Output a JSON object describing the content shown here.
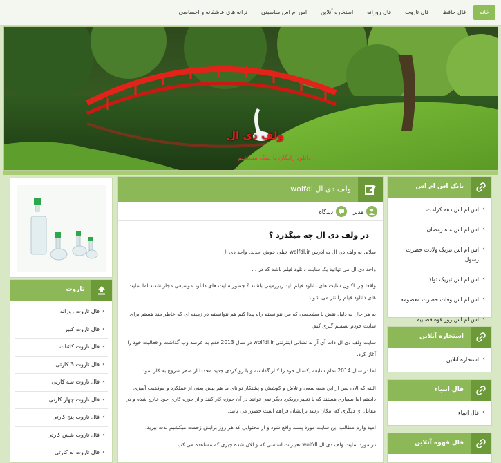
{
  "nav": {
    "items": [
      {
        "label": "خانه",
        "active": true
      },
      {
        "label": "فال حافظ"
      },
      {
        "label": "فال تاروت"
      },
      {
        "label": "فال روزانه"
      },
      {
        "label": "استخاره آنلاین"
      },
      {
        "label": "اس ام اس مناسبتی"
      },
      {
        "label": "ترانه های عاشقانه و احساسی"
      }
    ]
  },
  "banner": {
    "site_title": "ولف دی ال",
    "tagline": "دانلود رایگان با لینک مستقیم"
  },
  "article": {
    "title": "ولف دی ال wolfdl",
    "meta_author": "مدیر",
    "meta_comments": "دیدگاه",
    "heading": "در ولف دی ال چه میگذرد ؟",
    "paragraphs": [
      "سلام. به ولف دی ال به آدرس wolfdl.ir خیلی خوش آمدید. واحد دی ال",
      "واحد دی ال می توانید یک سایت دانلود فیلم باشد که در ...",
      "واقعا چرا اکنون سایت های دانلود فیلم باید زیرزمینی باشند ؟ چطور سایت های دانلود موسیقی مجاز شدند اما سایت های دانلود فیلم را نتر می شوند.",
      "به هر حال به دلیل نقض نا مشخصی که من نتوانستم راه پیدا کنم هم نتوانستم در زمینه ای که خاطر مند هستم برای سایت خودم تصمیم گیری کنم.",
      "سایت ولف دی ال دات آی آر به نشانی اینترنتی wolfdl.ir در سال 2013 قدم به عرصه وب گذاشت و فعالیت خود را آغاز کرد.",
      "اما در سال 2014 تمام سابقه یکسال خود را کنار گذاشته و با رویکردی جدید مجددا از صفر شروع به کار نمود.",
      "البته که الان پس از این همه سعی و تلاش و کوشش و پشتکار توانای ما هم پیش یعنی از عملکرد و موفقیت آمیزی داشتم اما بسیاری هستند که با تغییر رویکرد دیگر نمی توانند در آن حوزه کار کنند و از حوزه کاری خود خارج شده و در مقابل ای دیگری که امکان رشد برایشان فراهم است حضور می یابند.",
      "امید وارم مطالب این سایت مورد پسند واقع شود و از محتوایی که هر روز برایش زحمت میکشیم لذت ببرید.",
      "در مورد سایت ولف دی ال wolfdl تغییرات اساسی که و الان شده چیزی که مشاهده می کنید."
    ]
  },
  "right_widgets": [
    {
      "title": "بانک اس ام اس",
      "items": [
        "اس ام اس دهه کرامت",
        "اس ام اس ماه رمضان",
        "اس ام اس تبریک ولادت حضرت رسول",
        "اس ام اس تبریک تولد",
        "اس ام اس وفات حضرت معصومه",
        "اس ام اس روز قوه قضاییه"
      ]
    },
    {
      "title": "استخاره آنلاین",
      "items": [
        "استخاره آنلاین"
      ]
    },
    {
      "title": "فال انبیاء",
      "items": [
        "فال انبیاء"
      ]
    },
    {
      "title": "فال قهوه آنلاین",
      "items": []
    }
  ],
  "left_widget": {
    "title": "تاروت",
    "items": [
      "فال تاروت روزانه",
      "فال تاروت کبیر",
      "فال تاروت کائنات",
      "فال تاروت 3 کارتی",
      "فال تاروت سه کارتی",
      "فال تاروت چهار کارتی",
      "فال تاروت پنج کارتی",
      "فال تاروت شش کارتی",
      "فال تاروت نه کارتی"
    ]
  },
  "colors": {
    "accent": "#8db858",
    "accent_dark": "#6d9a39",
    "title_red": "#e21c1c"
  },
  "icons": {
    "widget": "link-icon",
    "article": "edit-icon",
    "left": "upload-icon"
  }
}
